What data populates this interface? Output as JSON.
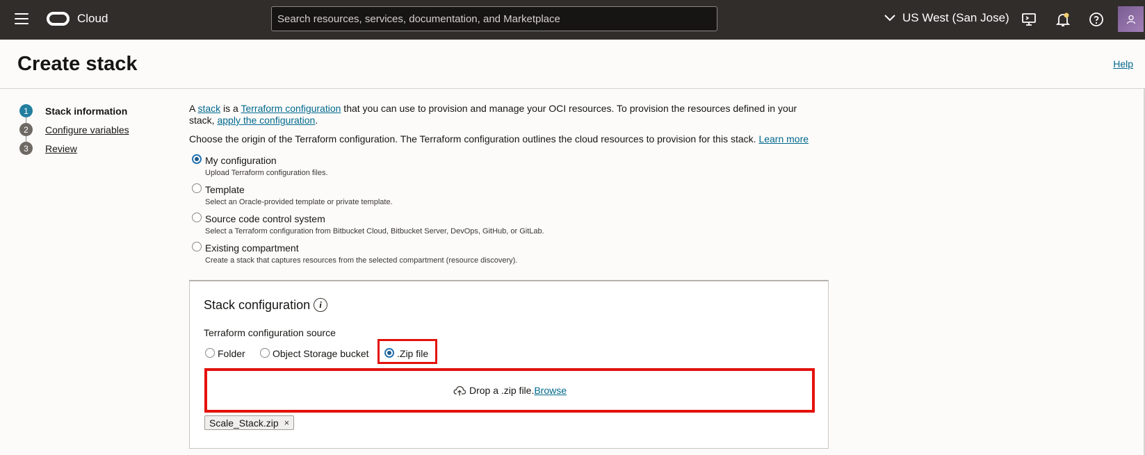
{
  "topbar": {
    "brand": "Cloud",
    "search_placeholder": "Search resources, services, documentation, and Marketplace",
    "region": "US West (San Jose)",
    "icons": [
      "menu-icon",
      "oracle-logo",
      "chevron-down-icon",
      "cloud-shell-icon",
      "bell-icon",
      "help-icon",
      "user-icon"
    ]
  },
  "header": {
    "title": "Create stack",
    "help": "Help"
  },
  "steps": [
    {
      "num": "1",
      "label": "Stack information",
      "active": true
    },
    {
      "num": "2",
      "label": "Configure variables",
      "active": false
    },
    {
      "num": "3",
      "label": "Review",
      "active": false
    }
  ],
  "intro": {
    "t1": "A ",
    "stack_link": "stack",
    "t2": " is a ",
    "terraform_link": "Terraform configuration",
    "t3": " that you can use to provision and manage your OCI resources. To provision the resources defined in your stack, ",
    "apply_link": "apply the configuration",
    "t4": ".",
    "origin_text": "Choose the origin of the Terraform configuration. The Terraform configuration outlines the cloud resources to provision for this stack. ",
    "learn_more": "Learn more"
  },
  "origin_options": [
    {
      "title": "My configuration",
      "desc": "Upload Terraform configuration files.",
      "selected": true
    },
    {
      "title": "Template",
      "desc": "Select an Oracle-provided template or private template.",
      "selected": false
    },
    {
      "title": "Source code control system",
      "desc": "Select a Terraform configuration from Bitbucket Cloud, Bitbucket Server, DevOps, GitHub, or GitLab.",
      "selected": false
    },
    {
      "title": "Existing compartment",
      "desc": "Create a stack that captures resources from the selected compartment (resource discovery).",
      "selected": false
    }
  ],
  "stack_config": {
    "title": "Stack configuration",
    "source_label": "Terraform configuration source",
    "sources": [
      {
        "label": "Folder",
        "selected": false
      },
      {
        "label": "Object Storage bucket",
        "selected": false
      },
      {
        "label": ".Zip file",
        "selected": true
      }
    ],
    "drop_text": "Drop a .zip file. ",
    "browse": "Browse",
    "file_chip": "Scale_Stack.zip",
    "chip_remove": "×"
  },
  "colors": {
    "topbar": "#312d2a",
    "link": "#00688c",
    "highlight": "#e3120b",
    "step_active": "#227e9e",
    "step_inactive": "#6f6964"
  }
}
